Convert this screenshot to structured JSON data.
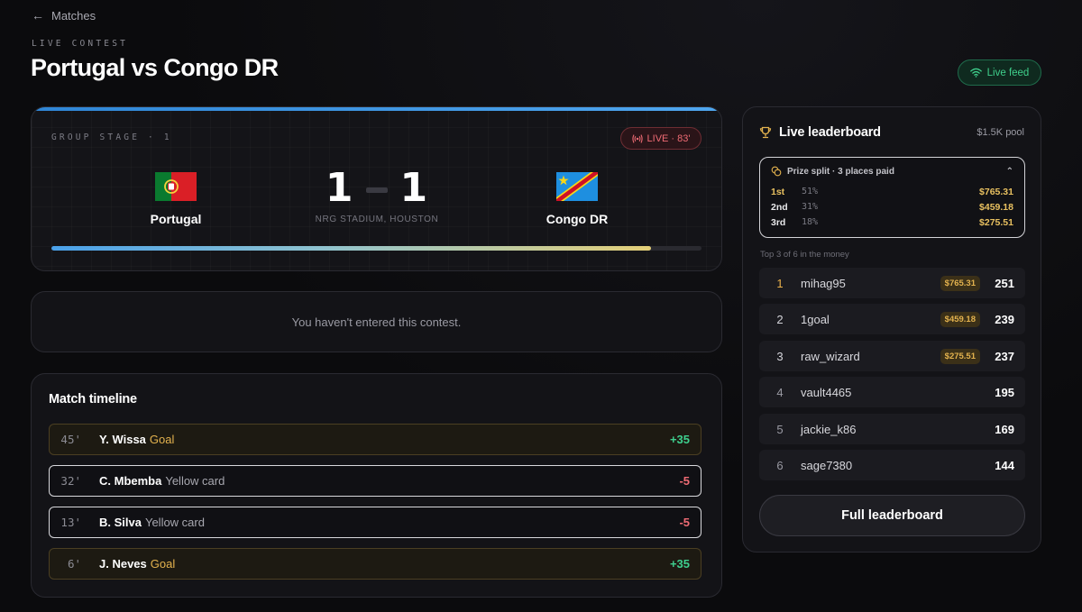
{
  "nav": {
    "back_label": "Matches"
  },
  "header": {
    "eyebrow": "LIVE CONTEST",
    "title": "Portugal vs Congo DR",
    "live_feed_label": "Live feed"
  },
  "match": {
    "stage": "GROUP STAGE · 1",
    "live_status": "LIVE · 83'",
    "home": {
      "name": "Portugal",
      "score": "1"
    },
    "away": {
      "name": "Congo DR",
      "score": "1"
    },
    "venue": "NRG STADIUM, HOUSTON",
    "progress_fraction": 0.922
  },
  "entry_notice": "You haven't entered this contest.",
  "timeline": {
    "title": "Match timeline",
    "events": [
      {
        "minute": "45'",
        "player": "Y. Wissa",
        "type": "Goal",
        "points": "+35",
        "kind": "goal"
      },
      {
        "minute": "32'",
        "player": "C. Mbemba",
        "type": "Yellow card",
        "points": "-5",
        "kind": "card"
      },
      {
        "minute": "13'",
        "player": "B. Silva",
        "type": "Yellow card",
        "points": "-5",
        "kind": "card"
      },
      {
        "minute": "6'",
        "player": "J. Neves",
        "type": "Goal",
        "points": "+35",
        "kind": "goal"
      }
    ]
  },
  "leaderboard": {
    "title": "Live leaderboard",
    "pool": "$1.5K pool",
    "prize_split": {
      "label": "Prize split · 3 places paid",
      "places": [
        {
          "place": "1st",
          "pct": "51%",
          "amount": "$765.31"
        },
        {
          "place": "2nd",
          "pct": "31%",
          "amount": "$459.18"
        },
        {
          "place": "3rd",
          "pct": "18%",
          "amount": "$275.51"
        }
      ]
    },
    "money_caption": "Top 3 of 6 in the money",
    "rows": [
      {
        "rank": "1",
        "user": "mihag95",
        "prize": "$765.31",
        "score": "251"
      },
      {
        "rank": "2",
        "user": "1goal",
        "prize": "$459.18",
        "score": "239"
      },
      {
        "rank": "3",
        "user": "raw_wizard",
        "prize": "$275.51",
        "score": "237"
      },
      {
        "rank": "4",
        "user": "vault4465",
        "prize": "",
        "score": "195"
      },
      {
        "rank": "5",
        "user": "jackie_k86",
        "prize": "",
        "score": "169"
      },
      {
        "rank": "6",
        "user": "sage7380",
        "prize": "",
        "score": "144"
      }
    ],
    "full_button_label": "Full leaderboard"
  },
  "colors": {
    "accent_blue": "#4fa6ef",
    "live_red": "#ef6b74",
    "positive_green": "#3ecf8e",
    "gold": "#e3b24e"
  }
}
